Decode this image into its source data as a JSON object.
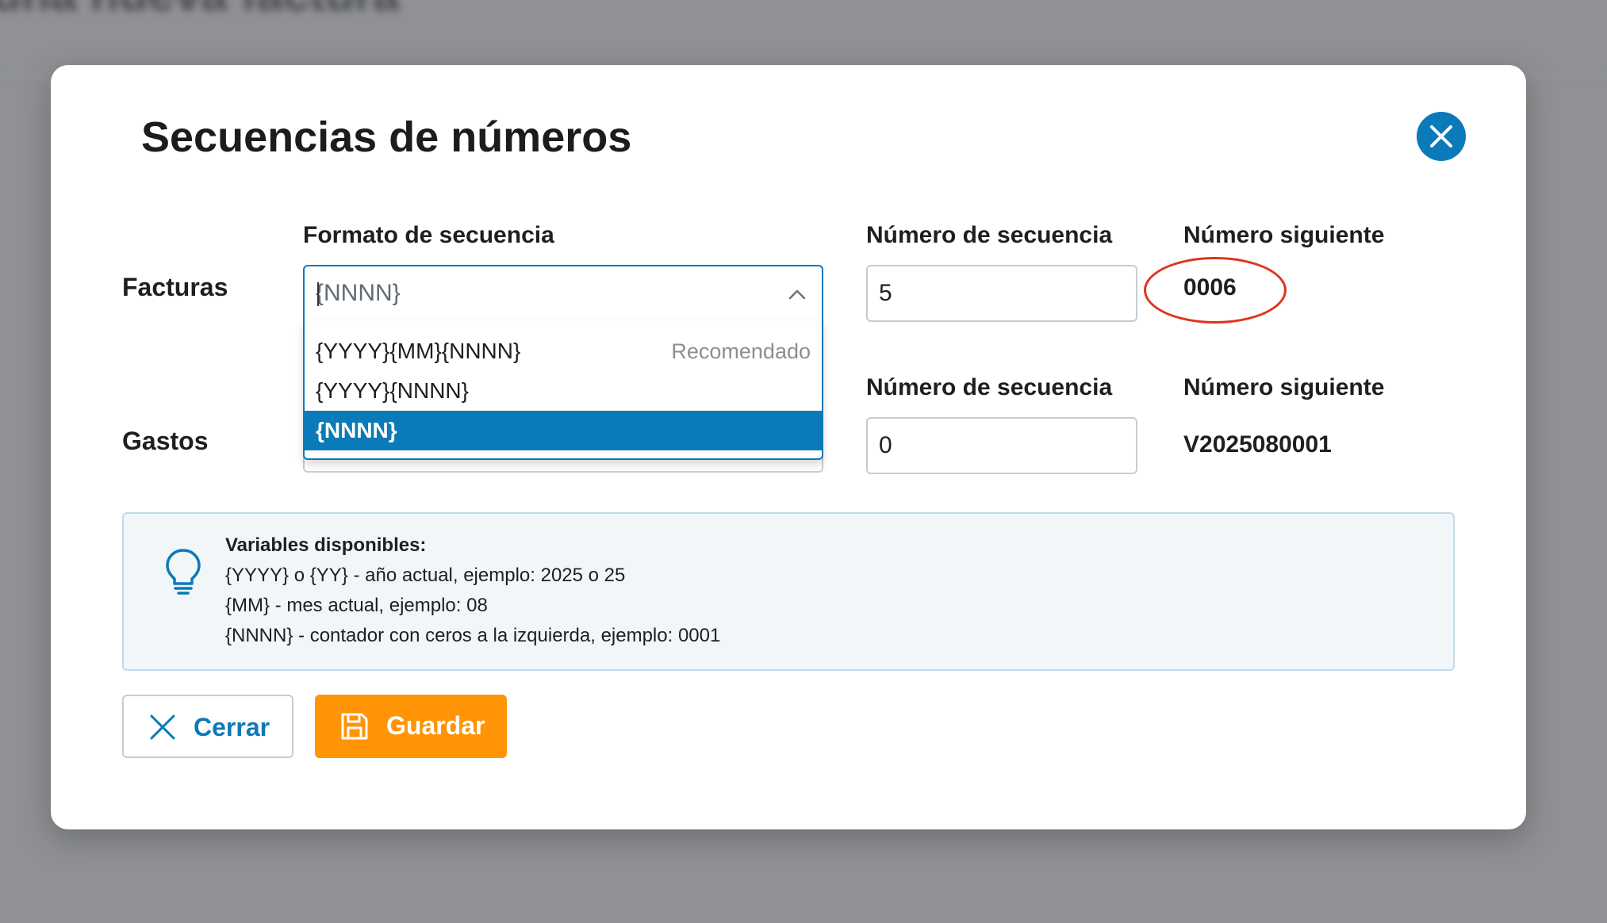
{
  "background": {
    "title": "una nueva factura"
  },
  "modal": {
    "title": "Secuencias de números",
    "columns": {
      "format": "Formato de secuencia",
      "sequence_number": "Número de secuencia",
      "next_number": "Número siguiente"
    },
    "rows": [
      {
        "label": "Facturas",
        "format_value": "{NNNN}",
        "sequence_number_label": "",
        "sequence_number": "5",
        "next_number": "0006"
      },
      {
        "label": "Gastos",
        "format_value": "",
        "sequence_number_label": "Número de secuencia",
        "next_number_label": "Número siguiente",
        "sequence_number": "0",
        "next_number": "V2025080001"
      }
    ],
    "dropdown": {
      "options": [
        {
          "label": "{YYYY}{MM}{NNNN}",
          "hint": "Recomendado"
        },
        {
          "label": "{YYYY}{NNNN}",
          "hint": ""
        },
        {
          "label": "{NNNN}",
          "hint": ""
        }
      ],
      "selected_index": 2
    },
    "info": {
      "heading": "Variables disponibles:",
      "lines": [
        "{YYYY} o {YY} - año actual, ejemplo: 2025 o 25",
        "{MM} - mes actual, ejemplo: 08",
        "{NNNN} - contador con ceros a la izquierda, ejemplo: 0001"
      ],
      "icon": "lightbulb-icon"
    },
    "buttons": {
      "close_label": "Cerrar",
      "save_label": "Guardar"
    },
    "colors": {
      "accent": "#0a7ab8",
      "save": "#ff9406",
      "annotation": "#e0341e"
    }
  }
}
